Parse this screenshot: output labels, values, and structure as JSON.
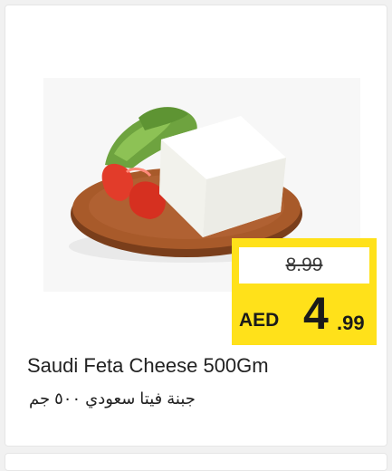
{
  "product": {
    "image_alt": "feta cheese block on wooden board",
    "name_en": "Saudi Feta Cheese 500Gm",
    "name_ar": "جبنة فيتا سعودي ٥٠٠ جم"
  },
  "price": {
    "old": "8.99",
    "currency": "AED",
    "major": "4",
    "minor": ".99"
  },
  "colors": {
    "price_box": "#ffe11a",
    "background": "#ffffff"
  }
}
